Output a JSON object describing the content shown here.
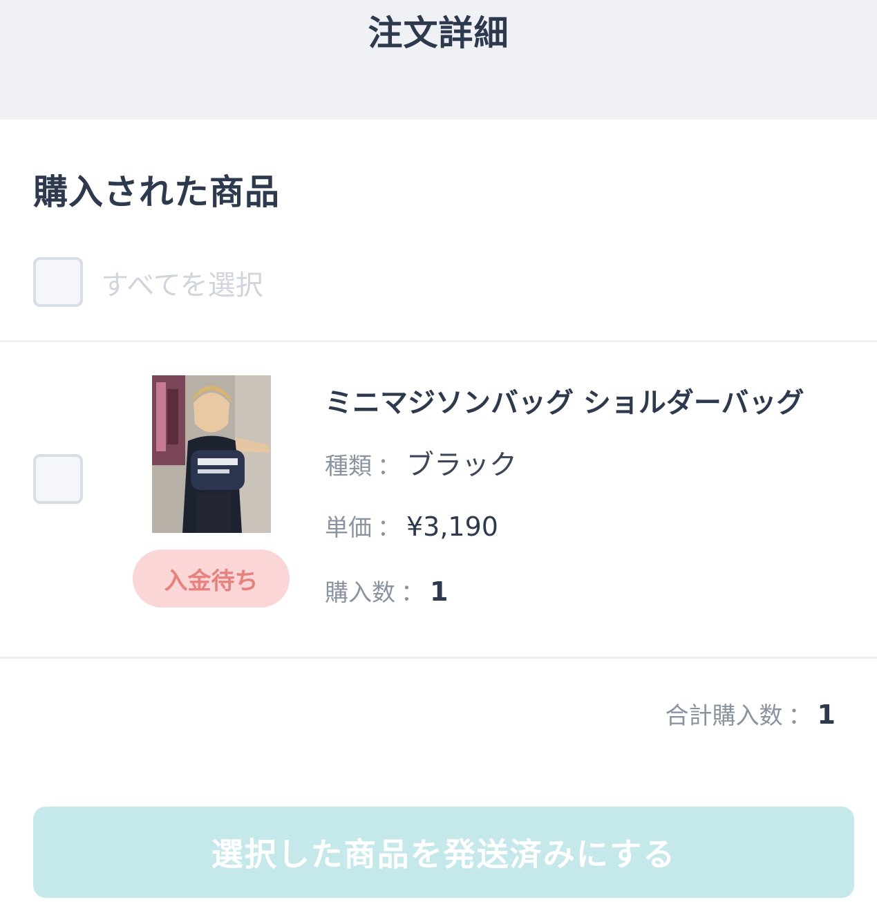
{
  "header": {
    "title": "注文詳細"
  },
  "section": {
    "title": "購入された商品"
  },
  "select_all": {
    "label": "すべてを選択",
    "checked": false
  },
  "items": [
    {
      "checked": false,
      "status": "入金待ち",
      "name": "ミニマジソンバッグ ショルダーバッグ",
      "type_label": "種類",
      "type_value": "ブラック",
      "price_label": "単価",
      "price_value": "¥3,190",
      "qty_label": "購入数",
      "qty_value": "1"
    }
  ],
  "total": {
    "label": "合計購入数",
    "value": "1"
  },
  "colon": "：",
  "action_button": {
    "label": "選択した商品を発送済みにする",
    "enabled": false
  },
  "colors": {
    "header_bg": "#eff1f5",
    "badge_bg": "#fad6d6",
    "badge_text": "#e6817d",
    "button_bg": "#c5e8ea",
    "title_text": "#2d3a4e"
  }
}
